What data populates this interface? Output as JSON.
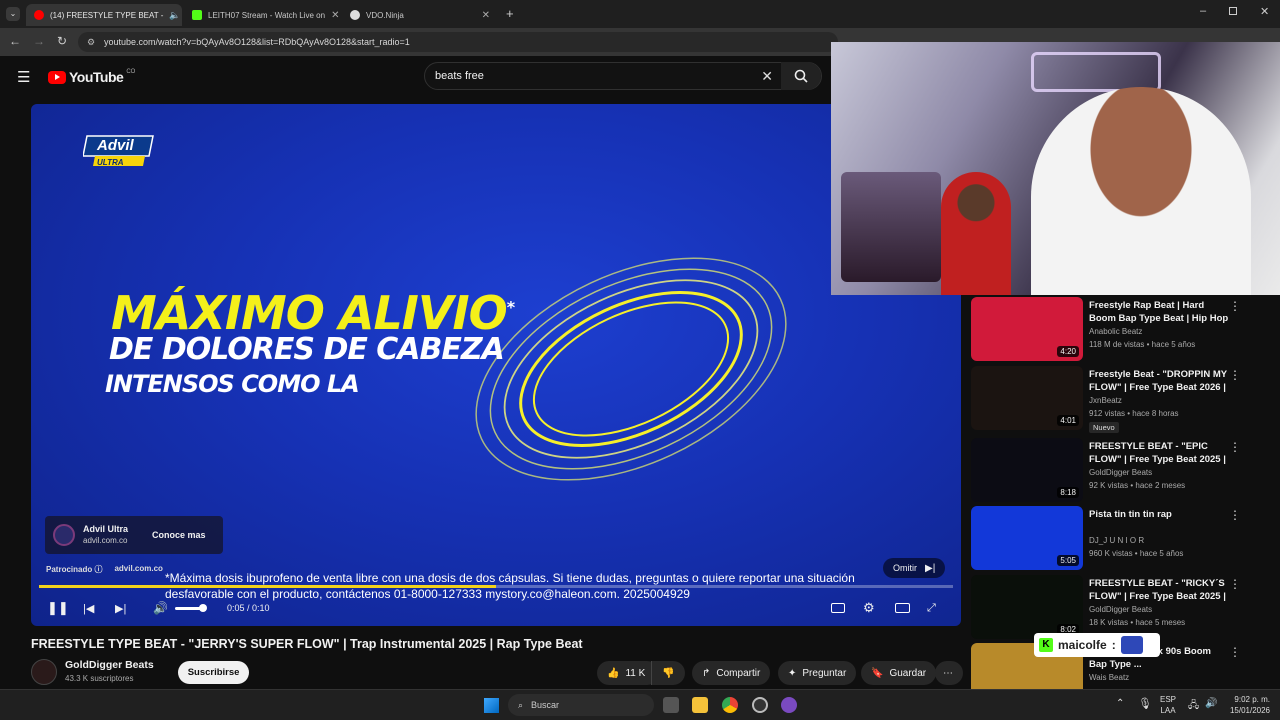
{
  "browser": {
    "tabs": [
      {
        "label": "(14) FREESTYLE TYPE BEAT -",
        "icon": "youtube-icon",
        "active": true
      },
      {
        "label": "LEITH07 Stream - Watch Live on",
        "icon": "kick-icon",
        "active": false
      },
      {
        "label": "VDO.Ninja",
        "icon": "vdo-ninja-icon",
        "active": false
      }
    ],
    "url": "youtube.com/watch?v=bQAyAv8O128&list=RDbQAyAv8O128&start_radio=1"
  },
  "youtube": {
    "logo": "YouTube",
    "region": "CO",
    "search_value": "beats free"
  },
  "ad": {
    "brand": "Advil",
    "brand_sub": "ULTRA",
    "headline": "MÁXIMO ALIVIO",
    "headline_mark": "*",
    "line2": "DE DOLORES DE CABEZA",
    "line3": "INTENSOS COMO LA",
    "disclaimer": "*Máxima dosis ibuprofeno de venta libre con una dosis de dos cápsulas. Si tiene dudas, preguntas o quiere reportar una situación desfavorable con el producto, contáctenos 01-8000-127333 mystory.co@haleon.com. 2025004929",
    "card_title": "Advil Ultra",
    "card_url": "advil.com.co",
    "card_cta": "Conoce mas",
    "sponsored": "Patrocinado",
    "sponsored_url": "advil.com.co",
    "skip": "Omitir",
    "time": "0:05 / 0:10",
    "progress": 0.5
  },
  "video": {
    "title": "FREESTYLE TYPE BEAT - \"JERRY'S SUPER FLOW\" | Trap Instrumental 2025 | Rap Type Beat",
    "channel": "GoldDigger Beats",
    "subscribers": "43.3 K suscriptores",
    "subscribe": "Suscribirse",
    "likes": "11 K",
    "share": "Compartir",
    "ask": "Preguntar",
    "save": "Guardar"
  },
  "overlay": {
    "kick_name": "maicolfe",
    "kick_sep": ":"
  },
  "sidebar": [
    {
      "title": "Freestyle Rap Beat | Hard Boom Bap Type Beat | Hip Hop ...",
      "channel": "Anabolic Beatz",
      "meta": "118 M de vistas • hace 5 años",
      "duration": "4:20",
      "badge": "",
      "thumb": "#d11a3a"
    },
    {
      "title": "Freestyle Beat - \"DROPPIN MY FLOW\" | Free Type Beat 2026 | ...",
      "channel": "JxnBeatz",
      "meta": "912 vistas • hace 8 horas",
      "duration": "4:01",
      "badge": "Nuevo",
      "thumb": "#1b1411"
    },
    {
      "title": "FREESTYLE BEAT - \"EPIC FLOW\" | Free Type Beat 2025 | Rap Tr...",
      "channel": "GoldDigger Beats",
      "meta": "92 K vistas • hace 2 meses",
      "duration": "8:18",
      "badge": "",
      "thumb": "#0c0c14"
    },
    {
      "title": "Pista tin tin tin rap",
      "channel": "DJ_J U N I O R",
      "meta": "960 K vistas • hace 5 años",
      "duration": "5:05",
      "badge": "",
      "thumb": "#1238d9"
    },
    {
      "title": "FREESTYLE BEAT - \"RICKY´S FLOW\" | Free Type Beat 2025 | ...",
      "channel": "GoldDigger Beats",
      "meta": "18 K vistas • hace 5 meses",
      "duration": "8:02",
      "badge": "",
      "thumb": "#0a0f0a"
    },
    {
      "title": "x Joey Bada$$ x 90s Boom Bap Type ...",
      "channel": "Wais Beatz",
      "meta": "",
      "duration": "",
      "badge": "",
      "thumb": "#b88a2a"
    }
  ],
  "taskbar": {
    "search": "Buscar",
    "lang1": "ESP",
    "lang2": "LAA",
    "time": "9:02 p. m.",
    "date": "15/01/2026"
  }
}
